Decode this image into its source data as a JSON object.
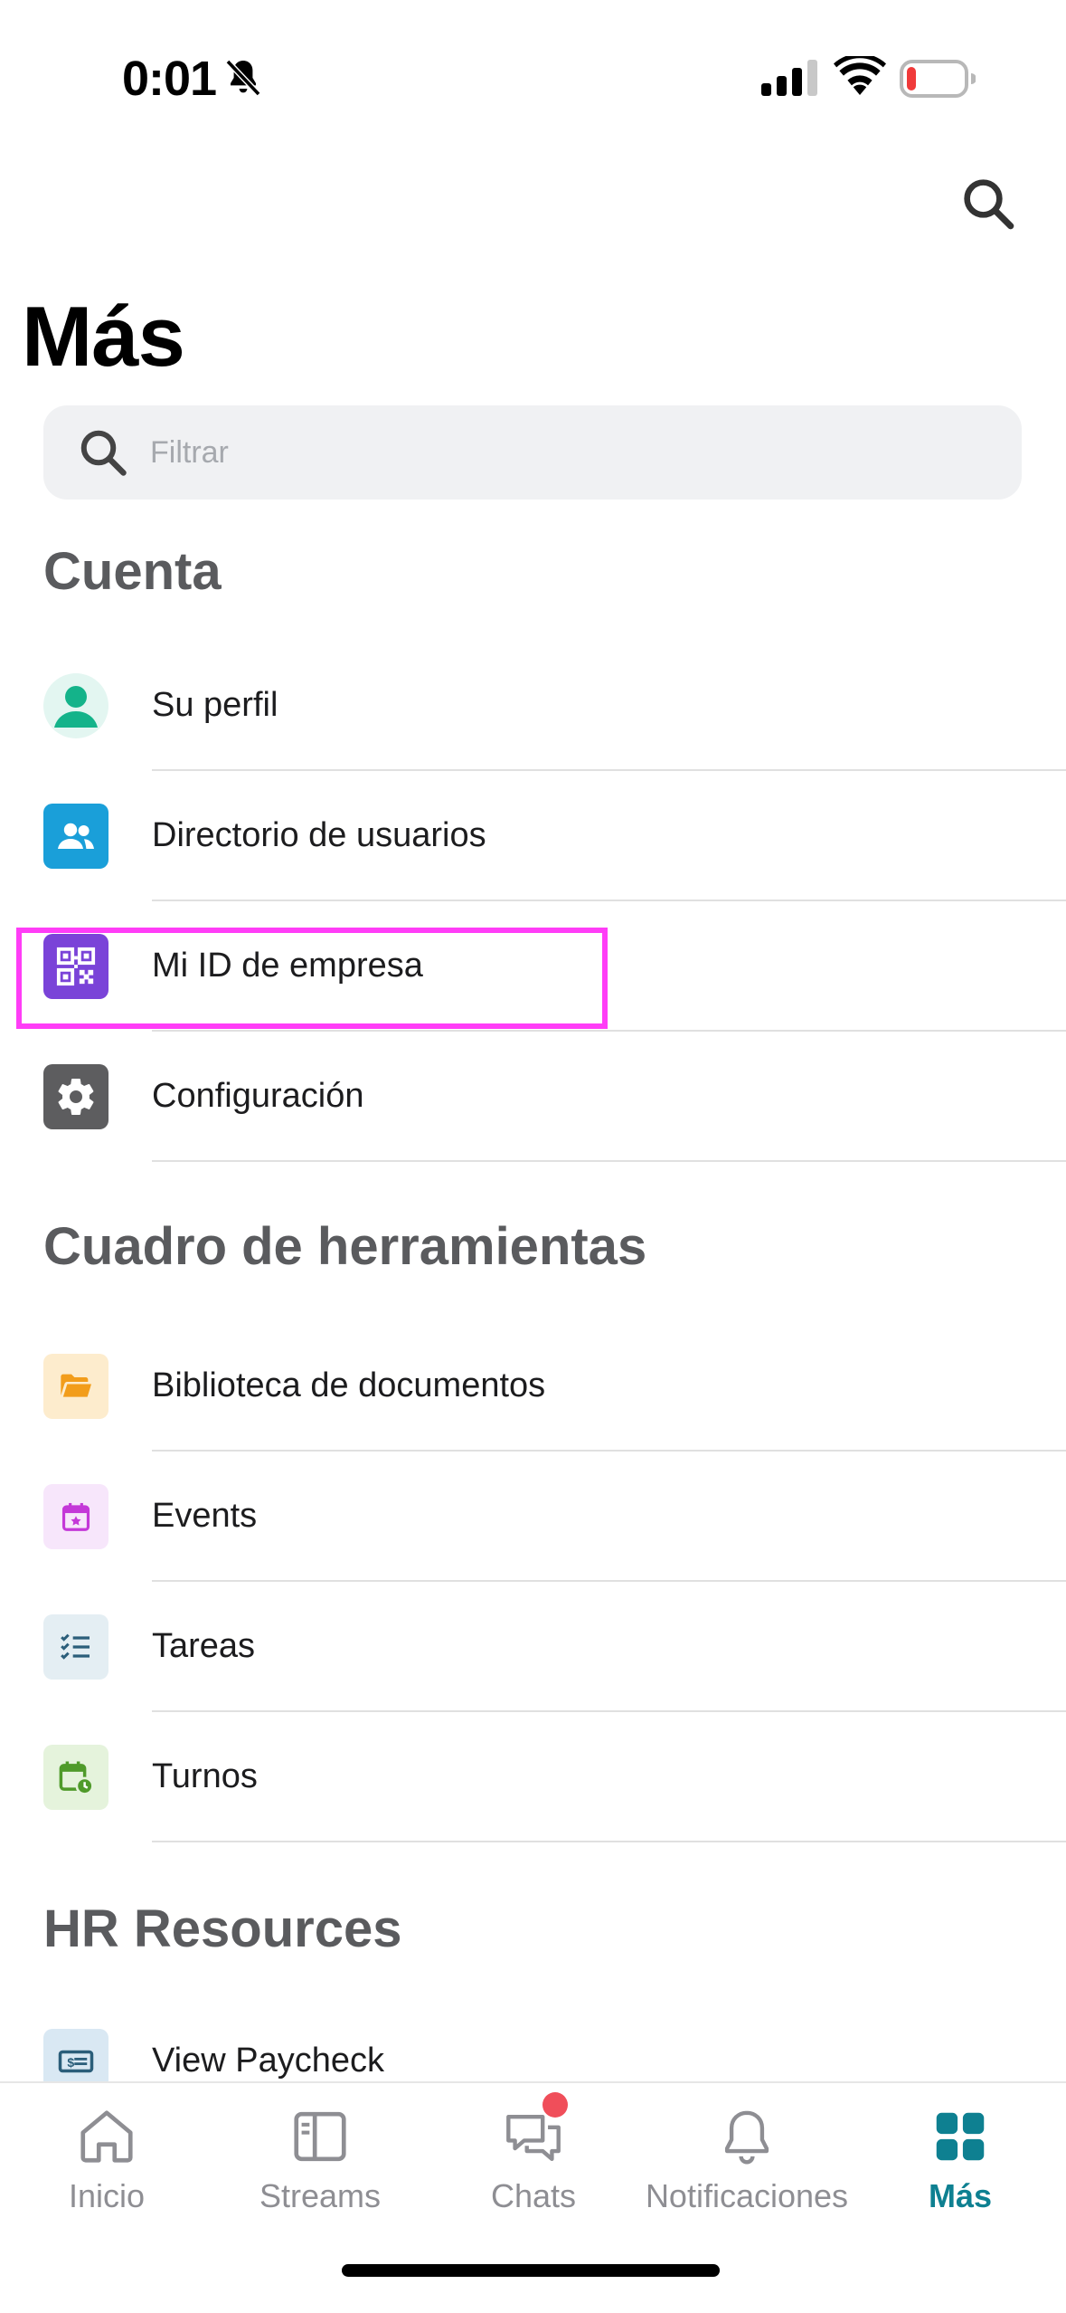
{
  "status_bar": {
    "time": "0:01",
    "battery_color": "#f03a3a"
  },
  "header": {
    "title": "Más",
    "search_icon": "search-icon"
  },
  "filter": {
    "placeholder": "Filtrar"
  },
  "sections": {
    "account": {
      "title": "Cuenta",
      "items": [
        {
          "label": "Su perfil",
          "icon": "profile-icon",
          "icon_bg": "#e3f6f1",
          "icon_color": "#14b38a"
        },
        {
          "label": "Directorio de usuarios",
          "icon": "users-icon",
          "icon_bg": "#1a9fd9",
          "icon_color": "#ffffff"
        },
        {
          "label": "Mi ID de empresa",
          "icon": "qr-code-icon",
          "icon_bg": "#7a43d8",
          "icon_color": "#ffffff"
        },
        {
          "label": "Configuración",
          "icon": "gear-icon",
          "icon_bg": "#5d5d5f",
          "icon_color": "#ffffff"
        }
      ]
    },
    "toolbox": {
      "title": "Cuadro de herramientas",
      "items": [
        {
          "label": "Biblioteca de documentos",
          "icon": "folder-icon",
          "icon_bg": "#fdeccd",
          "icon_color": "#f29d1b"
        },
        {
          "label": "Events",
          "icon": "calendar-star-icon",
          "icon_bg": "#f7e6fb",
          "icon_color": "#c438d8"
        },
        {
          "label": "Tareas",
          "icon": "checklist-icon",
          "icon_bg": "#e4eef3",
          "icon_color": "#2b5e7a"
        },
        {
          "label": "Turnos",
          "icon": "calendar-clock-icon",
          "icon_bg": "#e5f3dc",
          "icon_color": "#4f9a2a"
        }
      ]
    },
    "hr": {
      "title": "HR Resources",
      "items": [
        {
          "label": "View Paycheck",
          "icon": "paycheck-icon",
          "icon_bg": "#d9e8f3",
          "icon_color": "#2b5e7a"
        }
      ]
    }
  },
  "tab_bar": {
    "active_color": "#0e8091",
    "tabs": [
      {
        "label": "Inicio",
        "icon": "home-icon"
      },
      {
        "label": "Streams",
        "icon": "streams-icon"
      },
      {
        "label": "Chats",
        "icon": "chat-icon"
      },
      {
        "label": "Notificaciones",
        "icon": "bell-icon"
      },
      {
        "label": "Más",
        "icon": "grid-icon"
      }
    ]
  }
}
